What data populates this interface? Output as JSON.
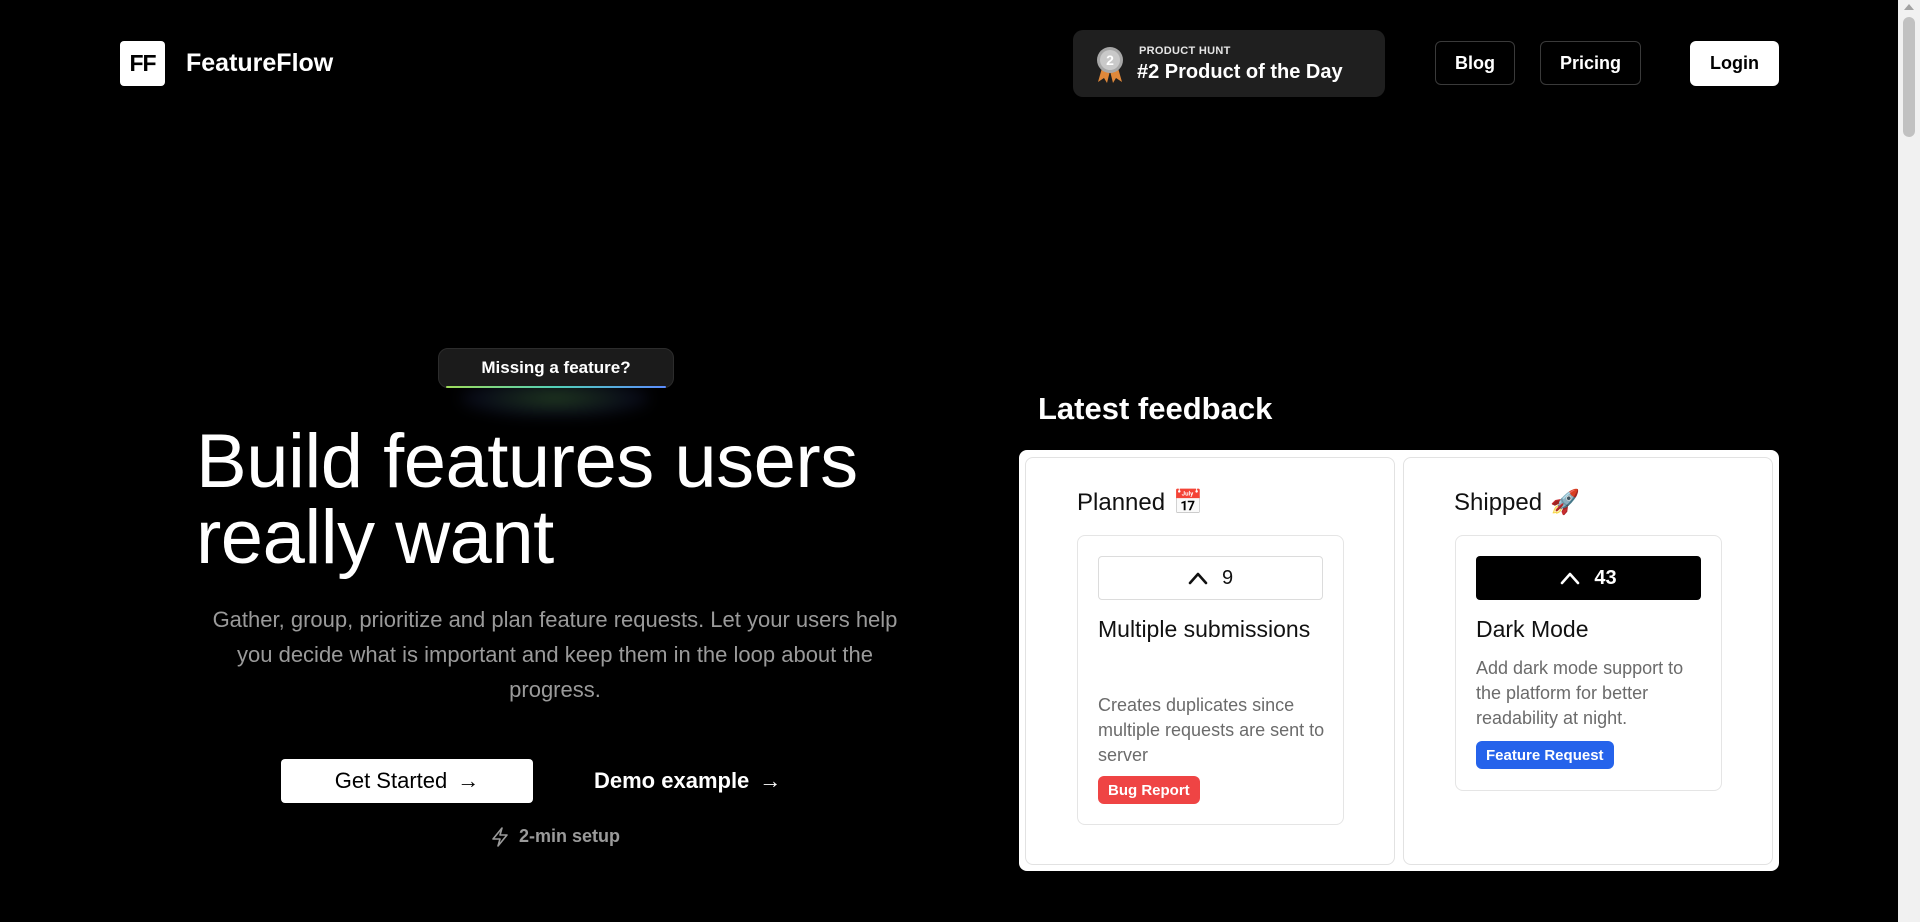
{
  "header": {
    "logo_mark": "FF",
    "logo_text": "FeatureFlow",
    "product_hunt": {
      "small_label": "PRODUCT HUNT",
      "big_label": "#2 Product of the Day",
      "medal_number": "2"
    },
    "nav": {
      "blog": "Blog",
      "pricing": "Pricing",
      "login": "Login"
    }
  },
  "hero": {
    "pill": "Missing a feature?",
    "title_line1": "Build features users",
    "title_line2": "really want",
    "subtitle": "Gather, group, prioritize and plan feature requests. Let your users help you decide what is important and keep them in the loop about the progress.",
    "get_started": "Get Started",
    "demo": "Demo example",
    "arrow": "→",
    "setup": "2-min setup"
  },
  "feedback": {
    "title": "Latest feedback",
    "columns": [
      {
        "heading": "Planned",
        "emoji": "📅",
        "card": {
          "votes": "9",
          "title": "Multiple submissions",
          "description": "Creates duplicates since multiple requests are sent to server",
          "tag": "Bug Report"
        }
      },
      {
        "heading": "Shipped",
        "emoji": "🚀",
        "card": {
          "votes": "43",
          "title": "Dark Mode",
          "description": "Add dark mode support to the platform for better readability at night.",
          "tag": "Feature Request"
        }
      }
    ]
  },
  "colors": {
    "background": "#000000",
    "bug_tag": "#ef4444",
    "feature_tag": "#2563eb"
  },
  "icons": {
    "medal": "medal-icon",
    "upvote": "chevron-up-icon",
    "setup": "lightning-icon"
  }
}
